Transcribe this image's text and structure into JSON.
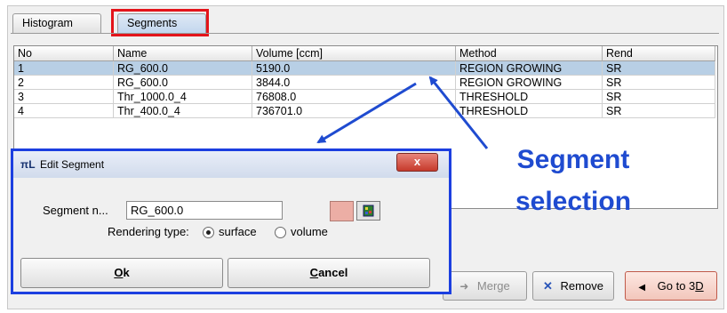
{
  "tabs": [
    {
      "label": "Histogram"
    },
    {
      "label": "Segments"
    }
  ],
  "table": {
    "columns": [
      "No",
      "Name",
      "Volume [ccm]",
      "Method",
      "Rend"
    ],
    "rows": [
      {
        "no": "1",
        "name": "RG_600.0",
        "volume": "5190.0",
        "method": "REGION GROWING",
        "rend": "SR"
      },
      {
        "no": "2",
        "name": "RG_600.0",
        "volume": "3844.0",
        "method": "REGION GROWING",
        "rend": "SR"
      },
      {
        "no": "3",
        "name": "Thr_1000.0_4",
        "volume": "76808.0",
        "method": "THRESHOLD",
        "rend": "SR"
      },
      {
        "no": "4",
        "name": "Thr_400.0_4",
        "volume": "736701.0",
        "method": "THRESHOLD",
        "rend": "SR"
      }
    ]
  },
  "buttons": {
    "merge": "Merge",
    "remove": "Remove",
    "go3d_prefix": "Go to 3",
    "go3d_underlined": "D"
  },
  "annotation": {
    "line1": "Segment",
    "line2": "selection",
    "color": "#1f4bd0"
  },
  "dialog": {
    "title": "Edit Segment",
    "close": "x",
    "segment_label": "Segment n...",
    "segment_value": "RG_600.0",
    "segment_color": "#ecaea5",
    "rendering_label": "Rendering type:",
    "option_surface": "surface",
    "option_volume": "volume",
    "selected_option": "surface",
    "ok_underlined": "O",
    "ok_rest": "k",
    "cancel_underlined": "C",
    "cancel_rest": "ancel"
  },
  "icons": {
    "dialog": "pmod-app-icon",
    "merge": "merge-arrow-icon",
    "remove": "x-icon",
    "go3d": "triangle-left-icon",
    "color_picker": "color-palette-icon"
  }
}
